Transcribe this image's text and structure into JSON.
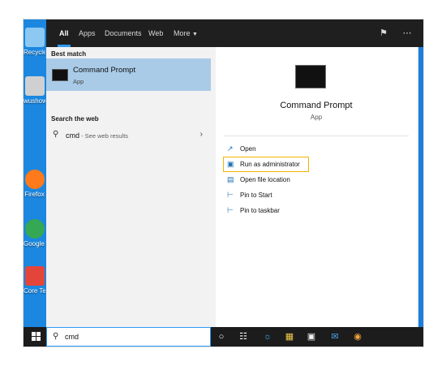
{
  "tabs": [
    {
      "label": "All"
    },
    {
      "label": "Apps"
    },
    {
      "label": "Documents"
    },
    {
      "label": "Web"
    },
    {
      "label": "More"
    }
  ],
  "left": {
    "best_match_heading": "Best match",
    "best_match": {
      "title": "Command Prompt",
      "subtitle": "App"
    },
    "search_web_heading": "Search the web",
    "web_result": {
      "query": "cmd",
      "suffix": " - See web results"
    }
  },
  "detail": {
    "title": "Command Prompt",
    "subtitle": "App",
    "actions": [
      {
        "label": "Open",
        "icon": "open-icon"
      },
      {
        "label": "Run as administrator",
        "icon": "shield-run-icon"
      },
      {
        "label": "Open file location",
        "icon": "file-location-icon"
      },
      {
        "label": "Pin to Start",
        "icon": "pin-icon"
      },
      {
        "label": "Pin to taskbar",
        "icon": "pin-icon"
      }
    ]
  },
  "desktop_icons": [
    {
      "label": "Recycle",
      "color": "#8cc8f2"
    },
    {
      "label": "wushow",
      "color": "#d0d0d0"
    },
    {
      "label": "Firefox",
      "color": "#ff7a1a"
    },
    {
      "label": "Google Chrome",
      "color": "#34a853"
    },
    {
      "label": "Core Te",
      "color": "#e4453a"
    }
  ],
  "taskbar": {
    "search_value": "cmd"
  },
  "colors": {
    "accent": "#2c9af5",
    "highlight_border": "#f3b400",
    "selected_row": "#a9cbe8"
  }
}
